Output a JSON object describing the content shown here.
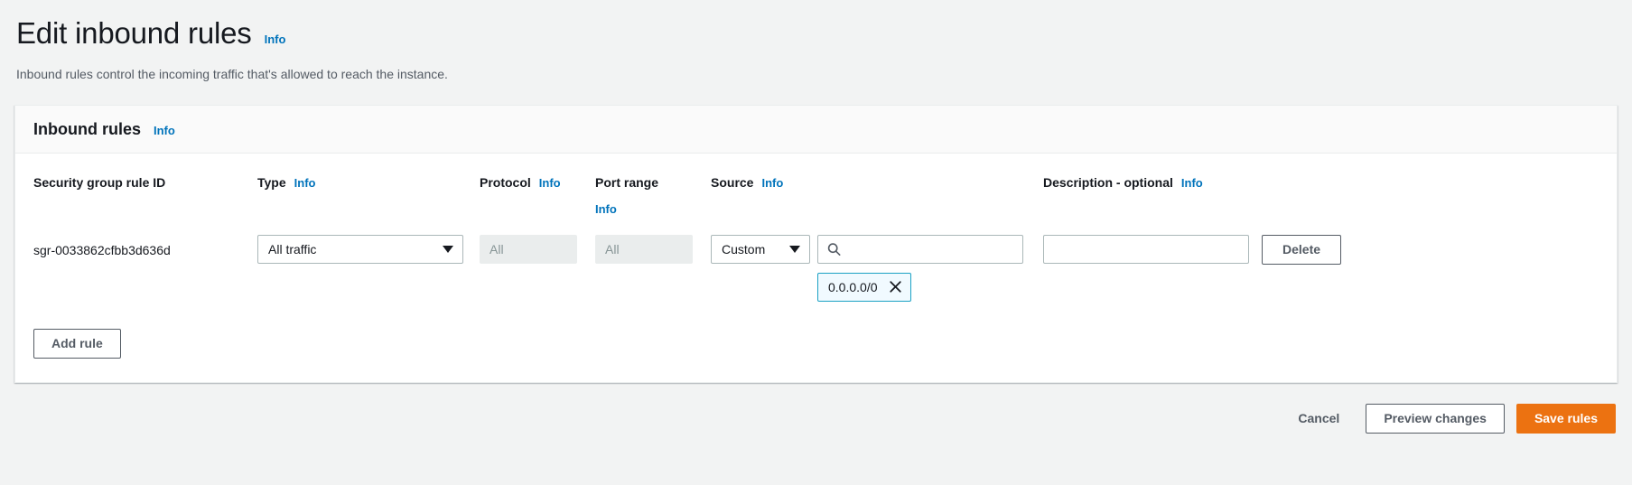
{
  "page": {
    "title": "Edit inbound rules",
    "info_label": "Info",
    "description": "Inbound rules control the incoming traffic that's allowed to reach the instance."
  },
  "card": {
    "title": "Inbound rules",
    "info_label": "Info"
  },
  "columns": {
    "rule_id": "Security group rule ID",
    "type": "Type",
    "type_info": "Info",
    "protocol": "Protocol",
    "protocol_info": "Info",
    "port_range": "Port range",
    "port_range_info": "Info",
    "source": "Source",
    "source_info": "Info",
    "description": "Description - optional",
    "description_info": "Info"
  },
  "rules": [
    {
      "rule_id": "sgr-0033862cfbb3d636d",
      "type_value": "All traffic",
      "protocol_value": "All",
      "protocol_disabled": true,
      "port_range_value": "All",
      "port_range_disabled": true,
      "source_value": "Custom",
      "source_search_value": "",
      "source_tokens": [
        "0.0.0.0/0"
      ],
      "description_value": "",
      "delete_label": "Delete"
    }
  ],
  "actions": {
    "add_rule": "Add rule",
    "cancel": "Cancel",
    "preview_changes": "Preview changes",
    "save_rules": "Save rules"
  },
  "icons": {
    "search": "search-icon",
    "dismiss": "close-icon",
    "caret": "chevron-down-icon"
  },
  "colors": {
    "accent_link": "#0073bb",
    "primary_button": "#ec7211",
    "token_border": "#1ba1c4",
    "token_background": "#f1faff",
    "page_background": "#f2f3f3"
  }
}
